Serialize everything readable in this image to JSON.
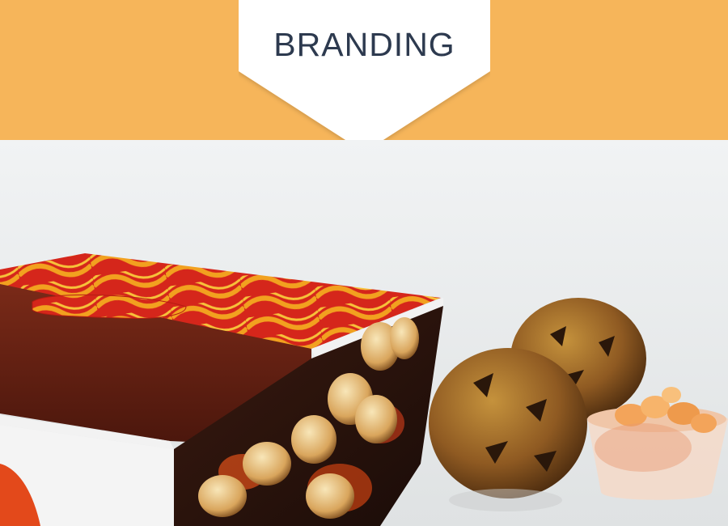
{
  "section": {
    "title": "BRANDING"
  },
  "colors": {
    "band": "#f6b55a",
    "badge": "#ffffff",
    "title_text": "#2d3a4f",
    "photo_background": "#e8ebec",
    "box_brown": "#6e2414",
    "box_pattern_orange": "#f2a11f",
    "box_pattern_red": "#d5261b"
  },
  "image": {
    "icon": "food-photo-icon",
    "subject": "takeaway-box-with-fried-balls-and-sauce-cup"
  }
}
